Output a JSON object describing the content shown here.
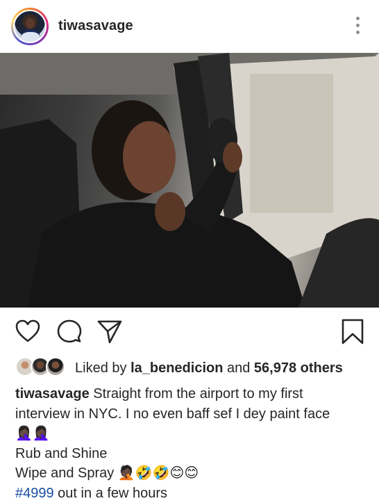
{
  "post": {
    "username": "tiwasavage"
  },
  "icons": {
    "more": "more-vertical-icon",
    "like": "heart-icon",
    "comment": "comment-icon",
    "share": "send-icon",
    "save": "bookmark-icon"
  },
  "likes": {
    "prefix": "Liked by ",
    "liker": "la_benedicion",
    "middle": " and ",
    "others": "56,978 others"
  },
  "caption": {
    "username": "tiwasavage",
    "line1": " Straight from the airport to my first",
    "line2": "interview in NYC. I no even baff sef I dey paint face",
    "line3": "🤦🏿‍♀️🤦🏿‍♀️",
    "line4": "Rub and Shine",
    "line5": "Wipe and Spray 🤦🏿🤣🤣😊😊",
    "hashtag": "#4999",
    "line6_rest": " out in a few hours"
  },
  "colors": {
    "text": "#262626",
    "hashtag": "#1a4fa0",
    "icon_gray": "#8e8e8e"
  }
}
